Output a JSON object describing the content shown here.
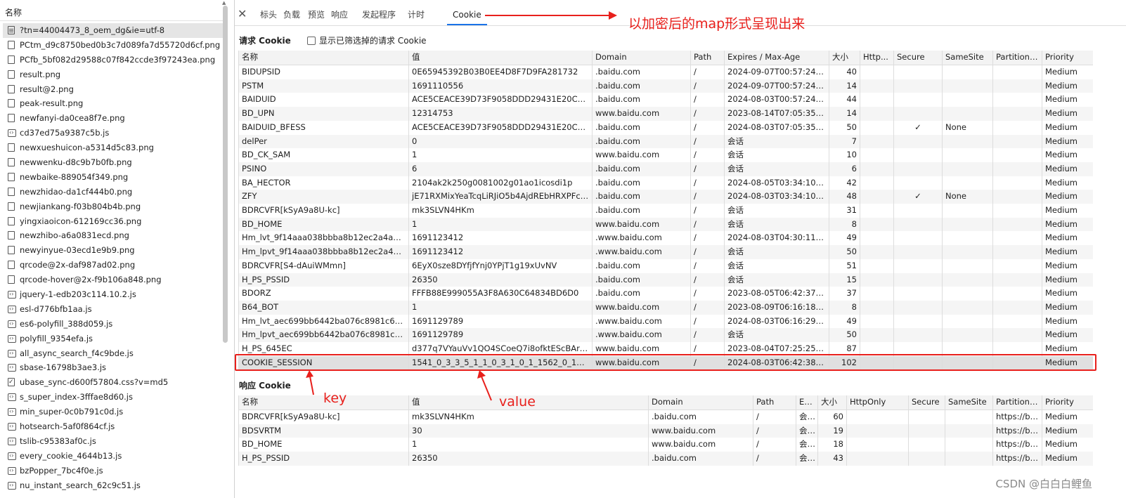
{
  "left_panel": {
    "header": "名称",
    "files": [
      {
        "name": "?tn=44004473_8_oem_dg&ie=utf-8",
        "icon": "doc-icon",
        "selected": true
      },
      {
        "name": "PCtm_d9c8750bed0b3c7d089fa7d55720d6cf.png",
        "icon": "file-icon"
      },
      {
        "name": "PCfb_5bf082d29588c07f842ccde3f97243ea.png",
        "icon": "file-icon"
      },
      {
        "name": "result.png",
        "icon": "file-icon"
      },
      {
        "name": "result@2.png",
        "icon": "file-icon"
      },
      {
        "name": "peak-result.png",
        "icon": "file-icon"
      },
      {
        "name": "newfanyi-da0cea8f7e.png",
        "icon": "file-icon"
      },
      {
        "name": "cd37ed75a9387c5b.js",
        "icon": "js-icon"
      },
      {
        "name": "newxueshuicon-a5314d5c83.png",
        "icon": "file-icon"
      },
      {
        "name": "newwenku-d8c9b7b0fb.png",
        "icon": "file-icon"
      },
      {
        "name": "newbaike-889054f349.png",
        "icon": "file-icon"
      },
      {
        "name": "newzhidao-da1cf444b0.png",
        "icon": "file-icon"
      },
      {
        "name": "newjiankang-f03b804b4b.png",
        "icon": "file-icon"
      },
      {
        "name": "yingxiaoicon-612169cc36.png",
        "icon": "file-icon"
      },
      {
        "name": "newzhibo-a6a0831ecd.png",
        "icon": "file-icon"
      },
      {
        "name": "newyinyue-03ecd1e9b9.png",
        "icon": "file-icon"
      },
      {
        "name": "qrcode@2x-daf987ad02.png",
        "icon": "file-icon"
      },
      {
        "name": "qrcode-hover@2x-f9b106a848.png",
        "icon": "file-icon"
      },
      {
        "name": "jquery-1-edb203c114.10.2.js",
        "icon": "js-icon"
      },
      {
        "name": "esl-d776bfb1aa.js",
        "icon": "js-icon"
      },
      {
        "name": "es6-polyfill_388d059.js",
        "icon": "js-icon"
      },
      {
        "name": "polyfill_9354efa.js",
        "icon": "js-icon"
      },
      {
        "name": "all_async_search_f4c9bde.js",
        "icon": "js-icon"
      },
      {
        "name": "sbase-16798b3ae3.js",
        "icon": "js-icon"
      },
      {
        "name": "ubase_sync-d600f57804.css?v=md5",
        "icon": "css-icon"
      },
      {
        "name": "s_super_index-3fffae8d60.js",
        "icon": "js-icon"
      },
      {
        "name": "min_super-0c0b791c0d.js",
        "icon": "js-icon"
      },
      {
        "name": "hotsearch-5af0f864cf.js",
        "icon": "js-icon"
      },
      {
        "name": "tslib-c95383af0c.js",
        "icon": "js-icon"
      },
      {
        "name": "every_cookie_4644b13.js",
        "icon": "js-icon"
      },
      {
        "name": "bzPopper_7bc4f0e.js",
        "icon": "js-icon"
      },
      {
        "name": "nu_instant_search_62c9c51.js",
        "icon": "js-icon"
      }
    ]
  },
  "tabs": [
    "标头",
    "负载",
    "预览",
    "响应",
    "发起程序",
    "计时",
    "Cookie"
  ],
  "active_tab": "Cookie",
  "request_cookies": {
    "title": "请求 Cookie",
    "checkbox_label": "显示已筛选掉的请求 Cookie",
    "columns": [
      "名称",
      "值",
      "Domain",
      "Path",
      "Expires / Max-Age",
      "大小",
      "Http...",
      "Secure",
      "SameSite",
      "Partition ...",
      "Priority"
    ],
    "rows": [
      [
        "BIDUPSID",
        "0E65945392B03B0EE4D8F7D9FA281732",
        ".baidu.com",
        "/",
        "2024-09-07T00:57:24.007Z",
        "40",
        "",
        "",
        "",
        "",
        "Medium"
      ],
      [
        "PSTM",
        "1691110556",
        ".baidu.com",
        "/",
        "2024-09-07T00:57:24.007Z",
        "14",
        "",
        "",
        "",
        "",
        "Medium"
      ],
      [
        "BAIDUID",
        "ACE5CEACE39D73F9058DDD29431E20CB:FG=1",
        ".baidu.com",
        "/",
        "2024-08-03T00:57:24.007Z",
        "44",
        "",
        "",
        "",
        "",
        "Medium"
      ],
      [
        "BD_UPN",
        "12314753",
        "www.baidu.com",
        "/",
        "2023-08-14T07:05:35.000Z",
        "14",
        "",
        "",
        "",
        "",
        "Medium"
      ],
      [
        "BAIDUID_BFESS",
        "ACE5CEACE39D73F9058DDD29431E20CB:FG=1",
        ".baidu.com",
        "/",
        "2024-08-03T07:05:35.584Z",
        "50",
        "",
        "✓",
        "None",
        "",
        "Medium"
      ],
      [
        "delPer",
        "0",
        ".baidu.com",
        "/",
        "会话",
        "7",
        "",
        "",
        "",
        "",
        "Medium"
      ],
      [
        "BD_CK_SAM",
        "1",
        "www.baidu.com",
        "/",
        "会话",
        "10",
        "",
        "",
        "",
        "",
        "Medium"
      ],
      [
        "PSINO",
        "6",
        ".baidu.com",
        "/",
        "会话",
        "6",
        "",
        "",
        "",
        "",
        "Medium"
      ],
      [
        "BA_HECTOR",
        "2104ak2k250g0081002g01ao1icosdi1p",
        ".baidu.com",
        "/",
        "2024-08-05T03:34:10.000Z",
        "42",
        "",
        "",
        "",
        "",
        "Medium"
      ],
      [
        "ZFY",
        "jE71RXMixYeaTcqLiRJiO5b4AjdREbHRXPFcL9J7...",
        ".baidu.com",
        "/",
        "2024-08-03T03:34:10.585Z",
        "48",
        "",
        "✓",
        "None",
        "",
        "Medium"
      ],
      [
        "BDRCVFR[kSyA9a8U-kc]",
        "mk3SLVN4HKm",
        ".baidu.com",
        "/",
        "会话",
        "31",
        "",
        "",
        "",
        "",
        "Medium"
      ],
      [
        "BD_HOME",
        "1",
        "www.baidu.com",
        "/",
        "会话",
        "8",
        "",
        "",
        "",
        "",
        "Medium"
      ],
      [
        "Hm_lvt_9f14aaa038bbba8b12ec2a4a3e51d...",
        "1691123412",
        ".www.baidu.com",
        "/",
        "2024-08-03T04:30:11.000Z",
        "49",
        "",
        "",
        "",
        "",
        "Medium"
      ],
      [
        "Hm_lpvt_9f14aaa038bbba8b12ec2a4a3e51...",
        "1691123412",
        ".www.baidu.com",
        "/",
        "会话",
        "50",
        "",
        "",
        "",
        "",
        "Medium"
      ],
      [
        "BDRCVFR[S4-dAuiWMmn]",
        "6EyX0sze8DYfjfYnj0YPjT1g19xUvNV",
        ".baidu.com",
        "/",
        "会话",
        "51",
        "",
        "",
        "",
        "",
        "Medium"
      ],
      [
        "H_PS_PSSID",
        "26350",
        ".baidu.com",
        "/",
        "会话",
        "15",
        "",
        "",
        "",
        "",
        "Medium"
      ],
      [
        "BDORZ",
        "FFFB88E999055A3F8A630C64834BD6D0",
        ".baidu.com",
        "/",
        "2023-08-05T06:42:37.976Z",
        "37",
        "",
        "",
        "",
        "",
        "Medium"
      ],
      [
        "B64_BOT",
        "1",
        "www.baidu.com",
        "/",
        "2023-08-09T06:16:18.000Z",
        "8",
        "",
        "",
        "",
        "",
        "Medium"
      ],
      [
        "Hm_lvt_aec699bb6442ba076c8981c6dc490...",
        "1691129789",
        ".www.baidu.com",
        "/",
        "2024-08-03T06:16:29.000Z",
        "49",
        "",
        "",
        "",
        "",
        "Medium"
      ],
      [
        "Hm_lpvt_aec699bb6442ba076c8981c6dc49...",
        "1691129789",
        ".www.baidu.com",
        "/",
        "会话",
        "50",
        "",
        "",
        "",
        "",
        "Medium"
      ],
      [
        "H_PS_645EC",
        "d377q7VYauVv1QO4SCoeQ7i8ofktEScBArrPBu...",
        "www.baidu.com",
        "/",
        "2023-08-04T07:25:25.000Z",
        "87",
        "",
        "",
        "",
        "",
        "Medium"
      ],
      [
        "COOKIE_SESSION",
        "1541_0_3_3_5_1_1_0_3_1_0_1_1562_0_113_0_16...",
        "www.baidu.com",
        "/",
        "2024-08-03T06:42:38.000Z",
        "102",
        "",
        "",
        "",
        "",
        "Medium"
      ]
    ]
  },
  "response_cookies": {
    "title": "响应 Cookie",
    "columns": [
      "名称",
      "值",
      "Domain",
      "Path",
      "Exp...",
      "大小",
      "HttpOnly",
      "Secure",
      "SameSite",
      "Partition ...",
      "Priority"
    ],
    "rows": [
      [
        "BDRCVFR[kSyA9a8U-kc]",
        "mk3SLVN4HKm",
        ".baidu.com",
        "/",
        "会话",
        "60",
        "",
        "",
        "",
        "https://ba...",
        "Medium"
      ],
      [
        "BDSVRTM",
        "30",
        "www.baidu.com",
        "/",
        "会话",
        "19",
        "",
        "",
        "",
        "https://ba...",
        "Medium"
      ],
      [
        "BD_HOME",
        "1",
        "www.baidu.com",
        "/",
        "会话",
        "18",
        "",
        "",
        "",
        "https://ba...",
        "Medium"
      ],
      [
        "H_PS_PSSID",
        "26350",
        ".baidu.com",
        "/",
        "会话",
        "43",
        "",
        "",
        "",
        "https://ba...",
        "Medium"
      ]
    ]
  },
  "annotations": {
    "map_note": "以加密后的map形式呈现出来",
    "key_label": "key",
    "value_label": "value",
    "color": "#e8201c"
  },
  "watermark": "CSDN @白白白鲤鱼"
}
